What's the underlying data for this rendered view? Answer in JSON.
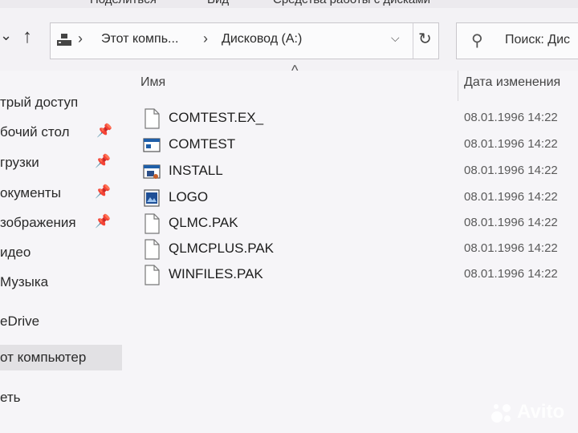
{
  "ribbon": {
    "tabs": [
      "Поделиться",
      "Вид",
      "Средства работы с дисками"
    ]
  },
  "address_bar": {
    "crumbs": [
      "Этот компь...",
      "Дисковод (A:)"
    ]
  },
  "search": {
    "placeholder": "Поиск: Дис"
  },
  "sidebar": {
    "items": [
      {
        "label": "трый доступ",
        "pinned": false
      },
      {
        "label": "бочий стол",
        "pinned": true
      },
      {
        "label": "грузки",
        "pinned": true
      },
      {
        "label": "окументы",
        "pinned": true
      },
      {
        "label": "зображения",
        "pinned": true
      },
      {
        "label": "идео",
        "pinned": false
      },
      {
        "label": "Музыка",
        "pinned": false
      },
      {
        "label": "eDrive",
        "pinned": false
      },
      {
        "label": "от компьютер",
        "pinned": false
      },
      {
        "label": "еть",
        "pinned": false
      }
    ]
  },
  "list": {
    "columns": {
      "name": "Имя",
      "date": "Дата изменения"
    },
    "files": [
      {
        "name": "COMTEST.EX_",
        "date": "08.01.1996 14:22",
        "icon": "blank-file-icon"
      },
      {
        "name": "COMTEST",
        "date": "08.01.1996 14:22",
        "icon": "application-icon"
      },
      {
        "name": "INSTALL",
        "date": "08.01.1996 14:22",
        "icon": "installer-icon"
      },
      {
        "name": "LOGO",
        "date": "08.01.1996 14:22",
        "icon": "bitmap-icon"
      },
      {
        "name": "QLMC.PAK",
        "date": "08.01.1996 14:22",
        "icon": "blank-file-icon"
      },
      {
        "name": "QLMCPLUS.PAK",
        "date": "08.01.1996 14:22",
        "icon": "blank-file-icon"
      },
      {
        "name": "WINFILES.PAK",
        "date": "08.01.1996 14:22",
        "icon": "blank-file-icon"
      }
    ]
  },
  "watermark": {
    "text": "Avito"
  },
  "colors": {
    "selected": "#e2e1e4",
    "accent": "#1f5fa8"
  }
}
